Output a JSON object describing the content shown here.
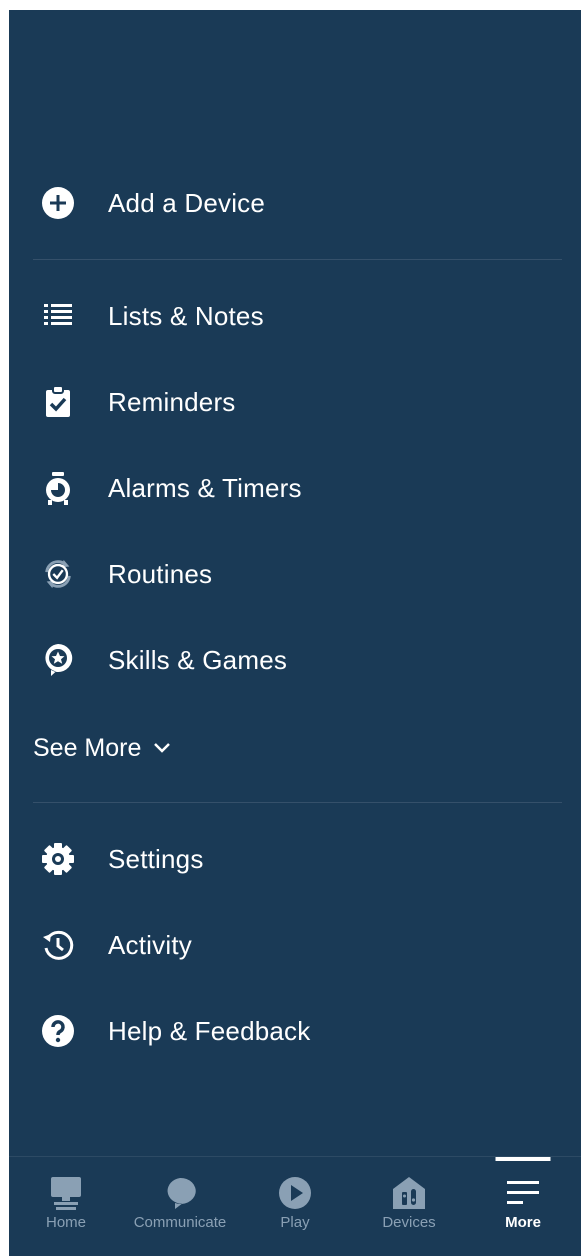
{
  "menu": {
    "add_device": "Add a Device",
    "lists_notes": "Lists & Notes",
    "reminders": "Reminders",
    "alarms_timers": "Alarms & Timers",
    "routines": "Routines",
    "skills_games": "Skills & Games",
    "see_more": "See More",
    "settings": "Settings",
    "activity": "Activity",
    "help_feedback": "Help & Feedback"
  },
  "tabs": {
    "home": "Home",
    "communicate": "Communicate",
    "play": "Play",
    "devices": "Devices",
    "more": "More",
    "active": "More"
  },
  "colors": {
    "background": "#1a3a56",
    "text": "#ffffff",
    "inactive_tab": "#8aa0b4"
  }
}
